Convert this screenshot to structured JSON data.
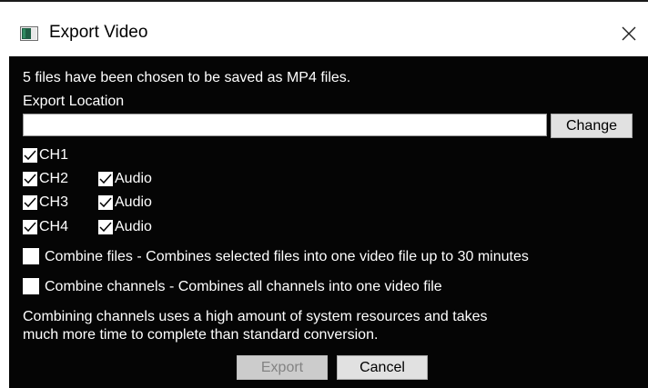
{
  "window": {
    "title": "Export Video",
    "close_icon": "close-icon"
  },
  "dialog": {
    "summary": "5 files have been chosen to be saved as MP4 files.",
    "location_label": "Export Location",
    "location_value": "",
    "change_label": "Change"
  },
  "channels": [
    {
      "label": "CH1",
      "checked": true
    },
    {
      "label": "CH2",
      "checked": true,
      "audio_label": "Audio",
      "audio_checked": true
    },
    {
      "label": "CH3",
      "checked": true,
      "audio_label": "Audio",
      "audio_checked": true
    },
    {
      "label": "CH4",
      "checked": true,
      "audio_label": "Audio",
      "audio_checked": true
    }
  ],
  "options": {
    "combine_files_label": "Combine files - Combines selected files into one video file up to 30 minutes",
    "combine_files_checked": false,
    "combine_channels_label": "Combine channels - Combines all channels into one video file",
    "combine_channels_checked": false
  },
  "warning": {
    "line1": "Combining channels uses a high amount of system resources and takes",
    "line2": "much more time to complete than standard conversion."
  },
  "buttons": {
    "export_label": "Export",
    "cancel_label": "Cancel"
  },
  "colors": {
    "dialog_background": "#050505",
    "text": "#ffffff",
    "button_face": "#e1e1e1",
    "button_disabled_text": "#838383"
  }
}
